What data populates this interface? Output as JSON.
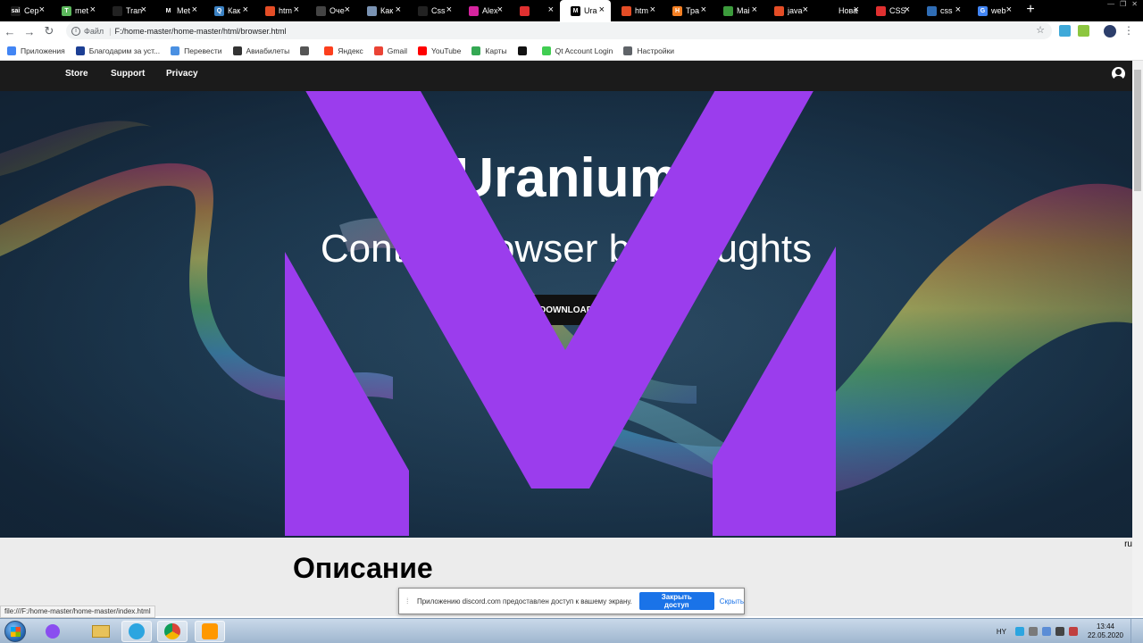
{
  "tabs": [
    {
      "label": "Сер",
      "fav": "#1a1a1a",
      "glyph": "sai"
    },
    {
      "label": "met",
      "fav": "#5cb85c",
      "glyph": "T"
    },
    {
      "label": "Tran",
      "fav": "#222",
      "glyph": ""
    },
    {
      "label": "Met",
      "fav": "#000",
      "glyph": "M"
    },
    {
      "label": "Как",
      "fav": "#3b82c4",
      "glyph": "Q"
    },
    {
      "label": "htm",
      "fav": "#e44d26",
      "glyph": ""
    },
    {
      "label": "Оче",
      "fav": "#444",
      "glyph": ""
    },
    {
      "label": "Как",
      "fav": "#7a93b3",
      "glyph": ""
    },
    {
      "label": "Css",
      "fav": "#222",
      "glyph": ""
    },
    {
      "label": "Alex",
      "fav": "#d6249f",
      "glyph": ""
    },
    {
      "label": "",
      "fav": "#e03030",
      "glyph": ""
    },
    {
      "label": "Ura",
      "fav": "#000",
      "glyph": "M",
      "active": true
    },
    {
      "label": "htm",
      "fav": "#e44d26",
      "glyph": ""
    },
    {
      "label": "Тра",
      "fav": "#f48024",
      "glyph": "H"
    },
    {
      "label": "Mai",
      "fav": "#3c9b3c",
      "glyph": ""
    },
    {
      "label": "java",
      "fav": "#e44d26",
      "glyph": ""
    },
    {
      "label": "Новая",
      "fav": "#000",
      "glyph": ""
    },
    {
      "label": "CSS",
      "fav": "#e03030",
      "glyph": ""
    },
    {
      "label": "css",
      "fav": "#2f6db5",
      "glyph": ""
    },
    {
      "label": "web",
      "fav": "#4285f4",
      "glyph": "G"
    }
  ],
  "address": {
    "scheme": "Файл",
    "url": "F:/home-master/home-master/html/browser.html"
  },
  "bookmarks": [
    {
      "label": "Приложения",
      "color": "#4285f4"
    },
    {
      "label": "Благодарим за уст...",
      "color": "#1c3f94"
    },
    {
      "label": "Перевести",
      "color": "#4a90e2"
    },
    {
      "label": "Авиабилеты",
      "color": "#333"
    },
    {
      "label": "",
      "color": "#555"
    },
    {
      "label": "Яндекс",
      "color": "#fc3f1d"
    },
    {
      "label": "Gmail",
      "color": "#ea4335"
    },
    {
      "label": "YouTube",
      "color": "#ff0000"
    },
    {
      "label": "Карты",
      "color": "#34a853"
    },
    {
      "label": "",
      "color": "#111"
    },
    {
      "label": "Qt Account Login",
      "color": "#41cd52"
    },
    {
      "label": "Настройки",
      "color": "#5f6368"
    }
  ],
  "site": {
    "nav": [
      "Store",
      "Support",
      "Privacy"
    ],
    "title": "Uranium",
    "subtitle": "Control browser by thoughts",
    "download": "DOWNLOAD",
    "section_heading": "Описание",
    "lang": "ru",
    "brand_color": "#9b3ded"
  },
  "status_url": "file:///F:/home-master/home-master/index.html",
  "share_notice": {
    "message": "Приложению discord.com предоставлен доступ к вашему экрану.",
    "stop": "Закрыть доступ",
    "hide": "Скрыть"
  },
  "taskbar": {
    "keyboard_lang": "HY",
    "time": "13:44",
    "date": "22.05.2020"
  }
}
